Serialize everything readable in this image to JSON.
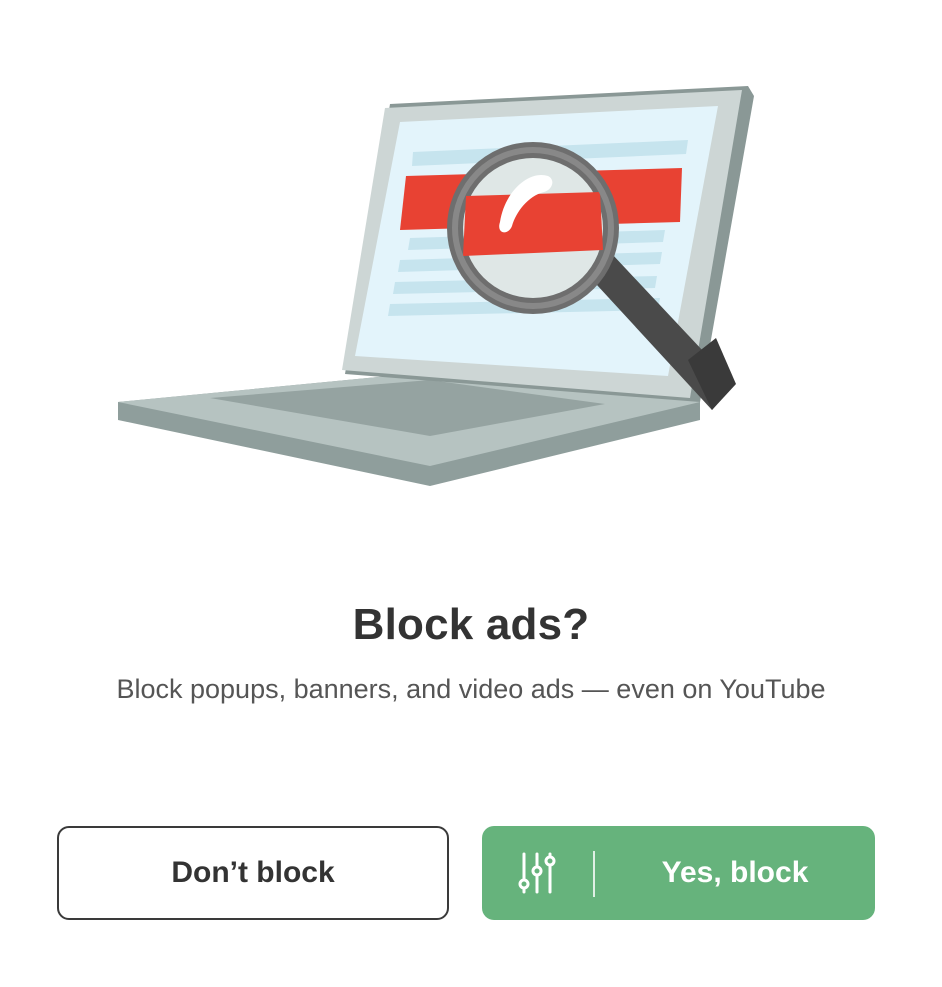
{
  "dialog": {
    "title": "Block ads?",
    "subtitle": "Block popups, banners, and video ads — even on YouTube"
  },
  "buttons": {
    "decline_label": "Don’t block",
    "accept_label": "Yes, block",
    "accept_icon": "sliders-icon"
  },
  "colors": {
    "accent_green": "#66b37c",
    "ad_banner_red": "#e84233",
    "screen_blue": "#e3f4fb"
  },
  "illustration": {
    "subject": "laptop-with-magnifying-glass"
  }
}
